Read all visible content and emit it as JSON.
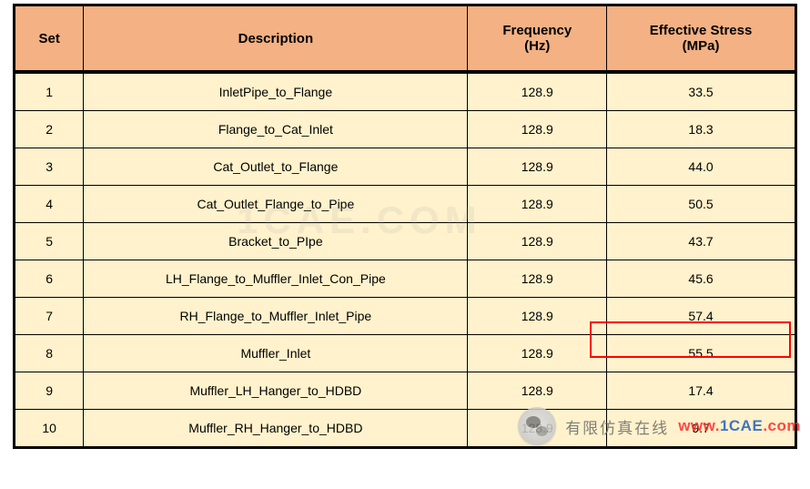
{
  "headers": {
    "set": "Set",
    "description": "Description",
    "frequency": "Frequency\n(Hz)",
    "stress": "Effective Stress\n(MPa)"
  },
  "rows": [
    {
      "set": "1",
      "description": "InletPipe_to_Flange",
      "frequency": "128.9",
      "stress": "33.5"
    },
    {
      "set": "2",
      "description": "Flange_to_Cat_Inlet",
      "frequency": "128.9",
      "stress": "18.3"
    },
    {
      "set": "3",
      "description": "Cat_Outlet_to_Flange",
      "frequency": "128.9",
      "stress": "44.0"
    },
    {
      "set": "4",
      "description": "Cat_Outlet_Flange_to_Pipe",
      "frequency": "128.9",
      "stress": "50.5"
    },
    {
      "set": "5",
      "description": "Bracket_to_PIpe",
      "frequency": "128.9",
      "stress": "43.7"
    },
    {
      "set": "6",
      "description": "LH_Flange_to_Muffler_Inlet_Con_Pipe",
      "frequency": "128.9",
      "stress": "45.6"
    },
    {
      "set": "7",
      "description": "RH_Flange_to_Muffler_Inlet_Pipe",
      "frequency": "128.9",
      "stress": "57.4"
    },
    {
      "set": "8",
      "description": "Muffler_Inlet",
      "frequency": "128.9",
      "stress": "55.5"
    },
    {
      "set": "9",
      "description": "Muffler_LH_Hanger_to_HDBD",
      "frequency": "128.9",
      "stress": "17.4"
    },
    {
      "set": "10",
      "description": "Muffler_RH_Hanger_to_HDBD",
      "frequency": "128.9",
      "stress": "9.7"
    }
  ],
  "watermark": {
    "overlay": "1CAE.COM",
    "cn_text": "有限仿真在线",
    "url_www": "www.",
    "url_domain": "1CAE",
    "url_com": ".com"
  },
  "highlight_row_index": 6,
  "chart_data": {
    "type": "table",
    "title": "",
    "columns": [
      "Set",
      "Description",
      "Frequency (Hz)",
      "Effective Stress (MPa)"
    ],
    "rows": [
      [
        1,
        "InletPipe_to_Flange",
        128.9,
        33.5
      ],
      [
        2,
        "Flange_to_Cat_Inlet",
        128.9,
        18.3
      ],
      [
        3,
        "Cat_Outlet_to_Flange",
        128.9,
        44.0
      ],
      [
        4,
        "Cat_Outlet_Flange_to_Pipe",
        128.9,
        50.5
      ],
      [
        5,
        "Bracket_to_PIpe",
        128.9,
        43.7
      ],
      [
        6,
        "LH_Flange_to_Muffler_Inlet_Con_Pipe",
        128.9,
        45.6
      ],
      [
        7,
        "RH_Flange_to_Muffler_Inlet_Pipe",
        128.9,
        57.4
      ],
      [
        8,
        "Muffler_Inlet",
        128.9,
        55.5
      ],
      [
        9,
        "Muffler_LH_Hanger_to_HDBD",
        128.9,
        17.4
      ],
      [
        10,
        "Muffler_RH_Hanger_to_HDBD",
        128.9,
        9.7
      ]
    ]
  }
}
